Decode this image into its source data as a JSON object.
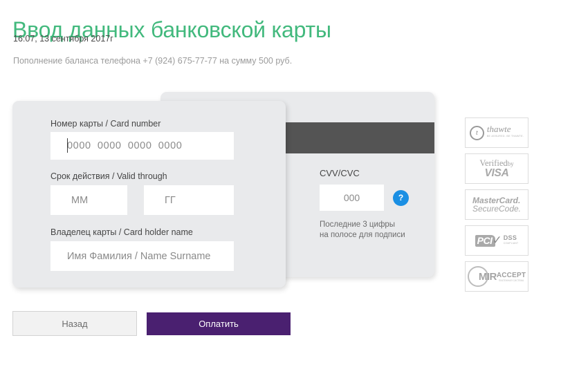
{
  "header": {
    "title": "Ввод данных банковской карты",
    "timestamp": "16:07, 13 сентября 2017г",
    "purpose": "Пополнение баланса телефона +7 (924) 675-77-77 на сумму 500 руб."
  },
  "form": {
    "card_number": {
      "label": "Номер карты / Card number",
      "placeholder": "0000  0000  0000  0000",
      "value": ""
    },
    "valid_through": {
      "label": "Срок действия / Valid through",
      "month_placeholder": "ММ",
      "month_value": "",
      "year_placeholder": "ГГ",
      "year_value": ""
    },
    "card_holder": {
      "label": "Владелец карты / Card holder name",
      "placeholder": "Имя Фамилия / Name Surname",
      "value": ""
    },
    "cvv": {
      "label": "CVV/CVC",
      "placeholder": "000",
      "value": "",
      "help_glyph": "?",
      "hint": "Последние 3 цифры\nна полосе для подписи"
    }
  },
  "badges": [
    {
      "name": "thawte",
      "mark": "t",
      "text": "thawte",
      "sub": "BE ASSURED. BE THAWTE."
    },
    {
      "name": "verified-by-visa",
      "line1": "Verified",
      "line1_small": "by",
      "line2": "VISA"
    },
    {
      "name": "mastercard-securecode",
      "line1": "MasterCard.",
      "line2": "SecureCode."
    },
    {
      "name": "pci-dss",
      "mark": "PCI",
      "line1": "DSS",
      "sub": "COMPLIANT"
    },
    {
      "name": "mir-accept",
      "line1": "MIR",
      "line2": "ACCEPT",
      "sub": "ПЛАТЕЖНАЯ СИСТЕМА"
    }
  ],
  "buttons": {
    "back": "Назад",
    "pay": "Оплатить"
  },
  "colors": {
    "title_green": "#42b97d",
    "pay_purple": "#4a2070",
    "card_grey": "#e9eaec",
    "magstripe": "#545454",
    "help_blue": "#1a8fe3"
  }
}
